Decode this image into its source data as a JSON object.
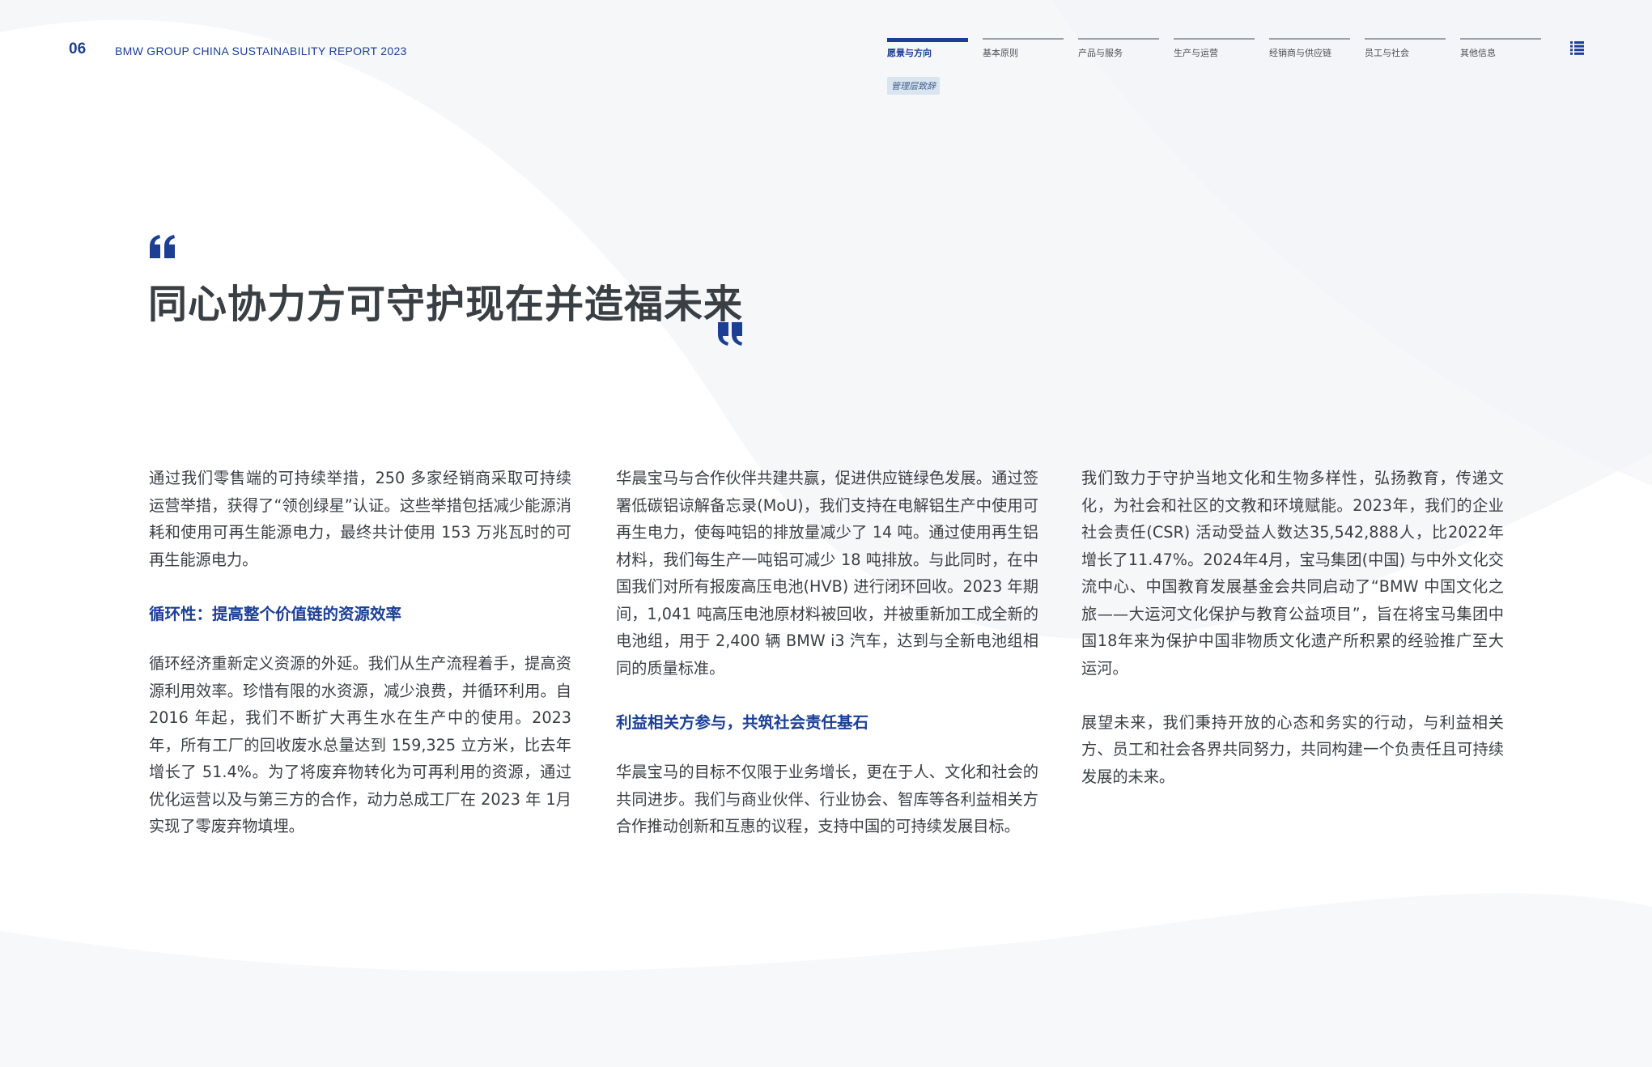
{
  "header": {
    "page_number": "06",
    "report_title": "BMW GROUP CHINA SUSTAINABILITY REPORT 2023",
    "nav_tabs": [
      {
        "label": "愿景与方向",
        "active": true
      },
      {
        "label": "基本原则",
        "active": false
      },
      {
        "label": "产品与服务",
        "active": false
      },
      {
        "label": "生产与运营",
        "active": false
      },
      {
        "label": "经销商与供应链",
        "active": false
      },
      {
        "label": "员工与社会",
        "active": false
      },
      {
        "label": "其他信息",
        "active": false
      }
    ],
    "sub_tag": "管理层致辞",
    "menu_icon": "list-icon"
  },
  "colors": {
    "brand_blue": "#1c3f94",
    "text": "#3a3f44",
    "tag_bg": "#dbe5f0"
  },
  "headline": "同心协力方可守护现在并造福未来",
  "columns": {
    "col1": {
      "p1": "通过我们零售端的可持续举措，250 多家经销商采取可持续运营举措，获得了“领创绿星”认证。这些举措包括减少能源消耗和使用可再生能源电力，最终共计使用 153 万兆瓦时的可再生能源电力。",
      "heading": "循环性：提高整个价值链的资源效率",
      "p2": "循环经济重新定义资源的外延。我们从生产流程着手，提高资源利用效率。珍惜有限的水资源，减少浪费，并循环利用。自 2016 年起，我们不断扩大再生水在生产中的使用。2023 年，所有工厂的回收废水总量达到 159,325 立方米，比去年增长了 51.4%。为了将废弃物转化为可再利用的资源，通过优化运营以及与第三方的合作，动力总成工厂在 2023 年 1月实现了零废弃物填埋。"
    },
    "col2": {
      "p1": "华晨宝马与合作伙伴共建共赢，促进供应链绿色发展。通过签署低碳铝谅解备忘录(MoU)，我们支持在电解铝生产中使用可再生电力，使每吨铝的排放量减少了 14 吨。通过使用再生铝材料，我们每生产一吨铝可减少 18 吨排放。与此同时，在中国我们对所有报废高压电池(HVB) 进行闭环回收。2023 年期间，1,041 吨高压电池原材料被回收，并被重新加工成全新的电池组，用于 2,400 辆 BMW i3 汽车，达到与全新电池组相同的质量标准。",
      "heading": "利益相关方参与，共筑社会责任基石",
      "p2": "华晨宝马的目标不仅限于业务增长，更在于人、文化和社会的共同进步。我们与商业伙伴、行业协会、智库等各利益相关方合作推动创新和互惠的议程，支持中国的可持续发展目标。"
    },
    "col3": {
      "p1": "我们致力于守护当地文化和生物多样性，弘扬教育，传递文化，为社会和社区的文教和环境赋能。2023年，我们的企业社会责任(CSR) 活动受益人数达35,542,888人，比2022年增长了11.47%。2024年4月，宝马集团(中国) 与中外文化交流中心、中国教育发展基金会共同启动了“BMW 中国文化之旅——大运河文化保护与教育公益项目”，旨在将宝马集团中国18年来为保护中国非物质文化遗产所积累的经验推广至大运河。",
      "p2": "展望未来，我们秉持开放的心态和务实的行动，与利益相关方、员工和社会各界共同努力，共同构建一个负责任且可持续发展的未来。"
    }
  }
}
